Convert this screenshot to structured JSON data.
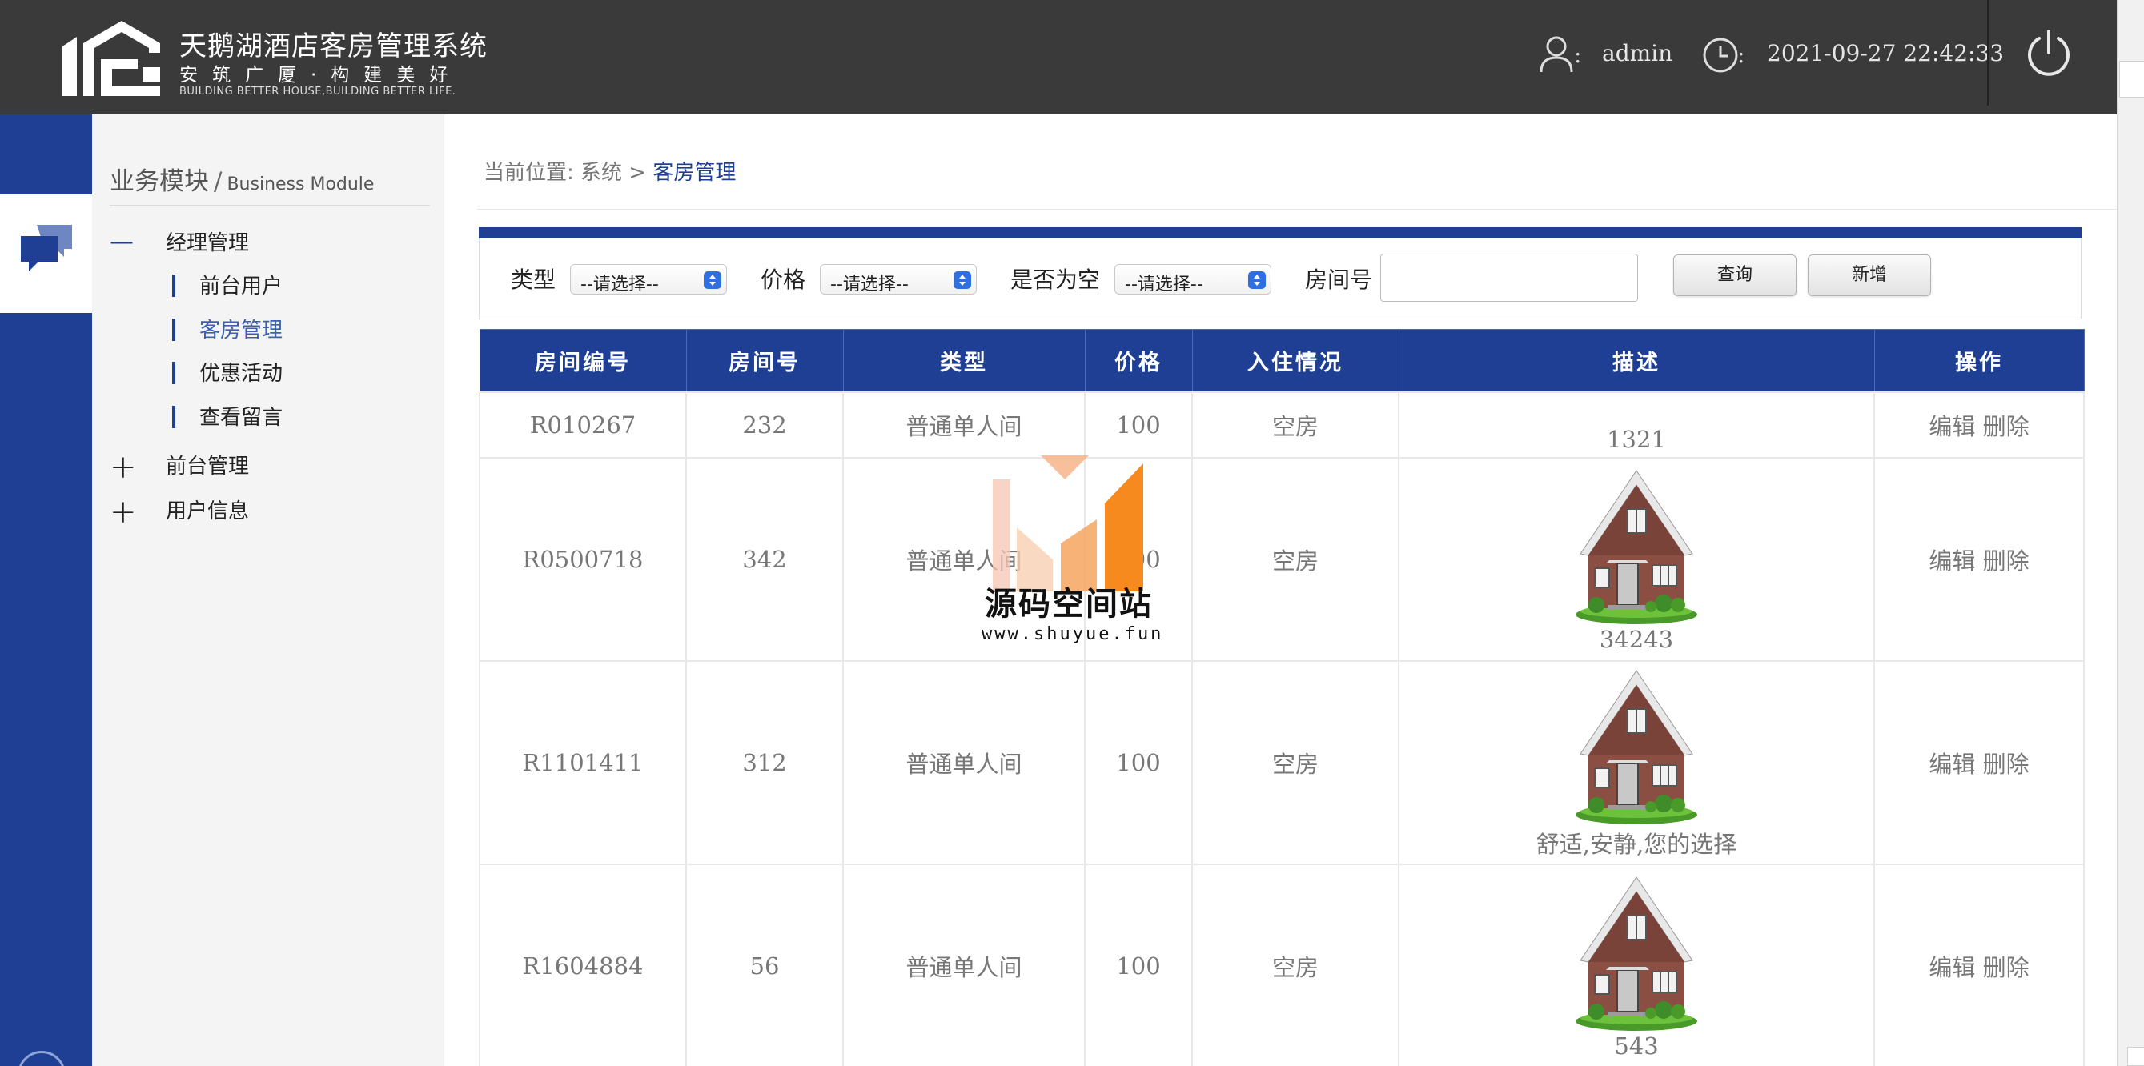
{
  "header": {
    "app_title": "天鹅湖酒店客房管理系统",
    "slogan": "安筑广厦·构建美好",
    "slogan_en": "BUILDING BETTER HOUSE,BUILDING BETTER LIFE.",
    "user_colon": ":",
    "user": "admin",
    "time_colon": ":",
    "time": "2021-09-27 22:42:33",
    "icons": [
      "logo-house-icon",
      "user-icon",
      "clock-icon",
      "power-icon"
    ]
  },
  "sidebar": {
    "title_cn": "业务模块",
    "title_sep": "/",
    "title_en": "Business Module",
    "groups": [
      {
        "symbol": "—",
        "label": "经理管理"
      },
      {
        "symbol": "+",
        "label": "前台管理"
      },
      {
        "symbol": "+",
        "label": "用户信息"
      }
    ],
    "items": [
      {
        "label": "前台用户"
      },
      {
        "label": "客房管理"
      },
      {
        "label": "优惠活动"
      },
      {
        "label": "查看留言"
      }
    ],
    "active_item": "客房管理"
  },
  "breadcrumb": {
    "prefix": "当前位置:",
    "path": "系统 >",
    "current": "客房管理"
  },
  "filters": {
    "type_label": "类型",
    "type_value": "--请选择--",
    "price_label": "价格",
    "price_value": "--请选择--",
    "empty_label": "是否为空",
    "empty_value": "--请选择--",
    "room_label": "房间号",
    "room_value": "",
    "query_button": "查询",
    "add_button": "新增"
  },
  "table": {
    "headers": [
      "房间编号",
      "房间号",
      "类型",
      "价格",
      "入住情况",
      "描述",
      "操作"
    ],
    "edit_label": "编辑",
    "delete_label": "删除",
    "rows": [
      {
        "id": "R010267",
        "room": "232",
        "type": "普通单人间",
        "price": "100",
        "status": "空房",
        "desc_top": "",
        "desc_bottom": "1321",
        "image": false
      },
      {
        "id": "R0500718",
        "room": "342",
        "type": "普通单人间",
        "price": "100",
        "status": "空房",
        "desc_top": "",
        "desc_bottom": "34243",
        "image": true
      },
      {
        "id": "R1101411",
        "room": "312",
        "type": "普通单人间",
        "price": "100",
        "status": "空房",
        "desc_top": "",
        "desc_bottom": "舒适,安静,您的选择",
        "image": true
      },
      {
        "id": "R1604884",
        "room": "56",
        "type": "普通单人间",
        "price": "100",
        "status": "空房",
        "desc_top": "",
        "desc_bottom": "543",
        "image": true
      }
    ]
  },
  "watermark": {
    "title": "源码空间站",
    "url": "www.shuyue.fun"
  },
  "colors": {
    "header_bg": "#3a3a3a",
    "brand_blue": "#1e3f94",
    "sidebar_bg": "#f4f4f4",
    "watermark_orange": "#f68a1e"
  }
}
